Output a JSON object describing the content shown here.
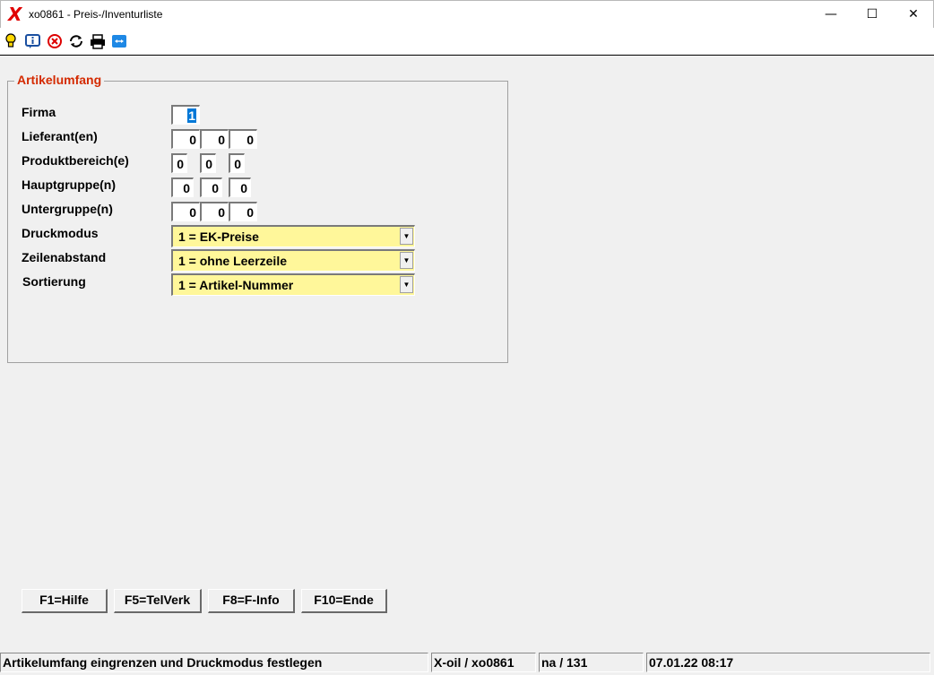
{
  "window": {
    "title": "xo0861 - Preis-/Inventurliste",
    "logo_glyph": "X",
    "minimize_glyph": "—",
    "maximize_glyph": "☐",
    "close_glyph": "✕"
  },
  "toolbar": {
    "icons": [
      "lightbulb-icon",
      "info-icon",
      "cancel-icon",
      "refresh-icon",
      "print-icon",
      "teamviewer-icon"
    ]
  },
  "form": {
    "group_title": "Artikelumfang",
    "labels": {
      "firma": "Firma",
      "lieferant": "Lieferant(en)",
      "produktbereich": "Produktbereich(e)",
      "hauptgruppe": "Hauptgruppe(n)",
      "untergruppe": "Untergruppe(n)",
      "druckmodus": "Druckmodus",
      "zeilenabstand": "Zeilenabstand",
      "sortierung": "Sortierung"
    },
    "values": {
      "firma": "1",
      "lieferant": [
        "0",
        "0",
        "0"
      ],
      "produktbereich": [
        "0",
        "0",
        "0"
      ],
      "hauptgruppe": [
        "0",
        "0",
        "0"
      ],
      "untergruppe": [
        "0",
        "0",
        "0"
      ],
      "druckmodus": "1 = EK-Preise",
      "zeilenabstand": "1 = ohne Leerzeile",
      "sortierung": "1 = Artikel-Nummer"
    },
    "dropdown_glyph": "▼"
  },
  "buttons": {
    "f1": "F1=Hilfe",
    "f5": "F5=TelVerk",
    "f8": "F8=F-Info",
    "f10": "F10=Ende"
  },
  "status": {
    "message": "Artikelumfang eingrenzen und Druckmodus festlegen",
    "program": "X-oil / xo0861",
    "user": "na / 131",
    "datetime": "07.01.22 08:17"
  },
  "colors": {
    "legend": "#d42a00",
    "combo_bg": "#fff79a",
    "logo": "#e00000",
    "selection": "#0078d7"
  }
}
